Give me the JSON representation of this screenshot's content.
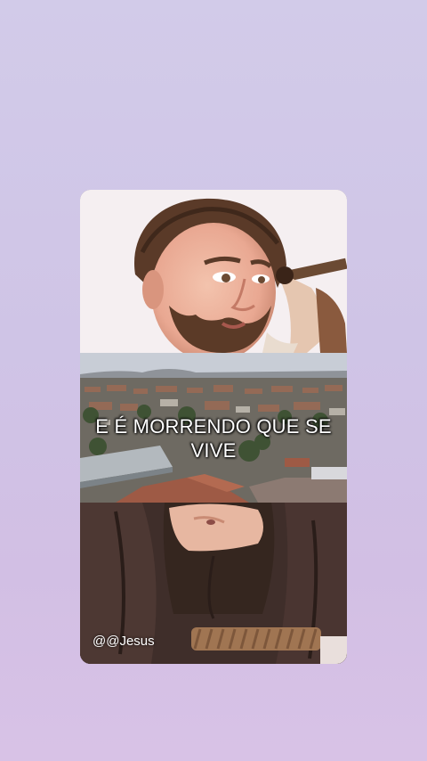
{
  "caption": {
    "line1": "E É MORRENDO QUE SE",
    "line2": "VIVE"
  },
  "watermark": "@@Jesus",
  "colors": {
    "background_top": "#d2cbe9",
    "background_bottom": "#d8c2e6",
    "caption_text": "#ffffff"
  },
  "scenes": [
    "saint-statue-face",
    "aerial-city-view",
    "statue-brown-robe"
  ]
}
